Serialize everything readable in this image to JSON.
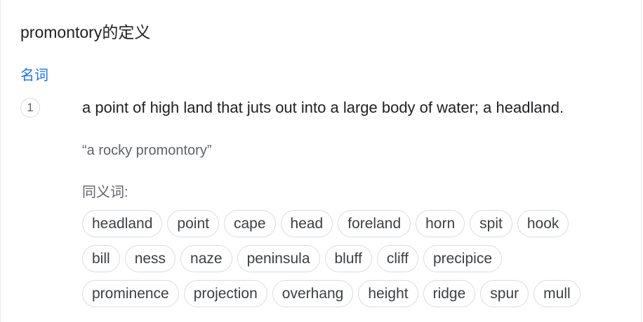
{
  "header": {
    "title": "promontory的定义"
  },
  "entry": {
    "part_of_speech": "名词",
    "senses": [
      {
        "number": "1",
        "definition": "a point of high land that juts out into a large body of water; a headland.",
        "example": "“a rocky promontory”",
        "synonyms_label": "同义词:",
        "synonym_rows": [
          [
            "headland",
            "point",
            "cape",
            "head",
            "foreland",
            "horn",
            "spit",
            "hook"
          ],
          [
            "bill",
            "ness",
            "naze",
            "peninsula",
            "bluff",
            "cliff",
            "precipice"
          ],
          [
            "prominence",
            "projection",
            "overhang",
            "height",
            "ridge",
            "spur",
            "mull"
          ]
        ]
      }
    ]
  }
}
